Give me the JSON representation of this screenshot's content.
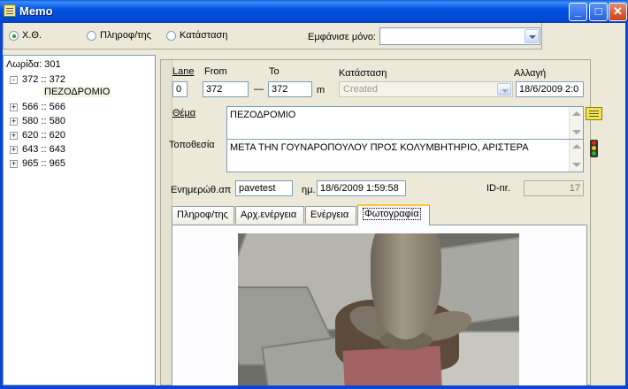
{
  "window": {
    "title": "Memo",
    "min_glyph": "_",
    "max_glyph": "□",
    "close_glyph": "✕"
  },
  "filter": {
    "radios": [
      {
        "label": "Χ.Θ.",
        "checked": true
      },
      {
        "label": "Πληροφ/της",
        "checked": false
      },
      {
        "label": "Κατάσταση",
        "checked": false
      }
    ],
    "show_only_label": "Εμφάνισε μόνο:",
    "show_only_value": ""
  },
  "tree": {
    "root": "Λωρίδα: 301",
    "nodes": [
      {
        "expander": "-",
        "label": "372 :: 372"
      },
      {
        "expander": "+",
        "label": "566 :: 566"
      },
      {
        "expander": "+",
        "label": "580 :: 580"
      },
      {
        "expander": "+",
        "label": "620 :: 620"
      },
      {
        "expander": "+",
        "label": "643 :: 643"
      },
      {
        "expander": "+",
        "label": "965 :: 965"
      }
    ],
    "selected_child": "ΠΕΖΟΔΡΟΜΙΟ"
  },
  "detail": {
    "lane_label": "Lane",
    "from_label": "From",
    "to_label": "To",
    "status_label": "Κατάσταση",
    "changed_label": "Αλλαγή",
    "lane": "0",
    "from": "372",
    "dash": "—",
    "to": "372",
    "unit": "m",
    "status": "Created",
    "changed": "18/6/2009 2:0",
    "subject_label": "Θέμα",
    "subject": "ΠΕΖΟΔΡΟΜΙΟ",
    "location_label": "Τοποθεσία",
    "location": "ΜΕΤΑ ΤΗΝ ΓΟΥΝΑΡΟΠΟΥΛΟΥ ΠΡΟΣ ΚΟΛΥΜΒΗΤΗΡΙΟ, ΑΡΙΣΤΕΡΑ",
    "updated_label": "Ενημερώθ.απ",
    "updated_by": "pavetest",
    "date_label": "ημ.",
    "date": "18/6/2009 1:59:58",
    "id_label": "ID-nr.",
    "id": "17",
    "note_icon": "note-icon",
    "status_icon": "traffic-light-icon"
  },
  "tabs": [
    {
      "label": "Πληροφ/της",
      "active": false
    },
    {
      "label": "Αρχ.ενέργεια",
      "active": false
    },
    {
      "label": "Ενέργεια",
      "active": false
    },
    {
      "label": "Φωτογραφία",
      "active": true
    }
  ],
  "photo": {
    "subject": "tree-on-pavement-photo"
  }
}
